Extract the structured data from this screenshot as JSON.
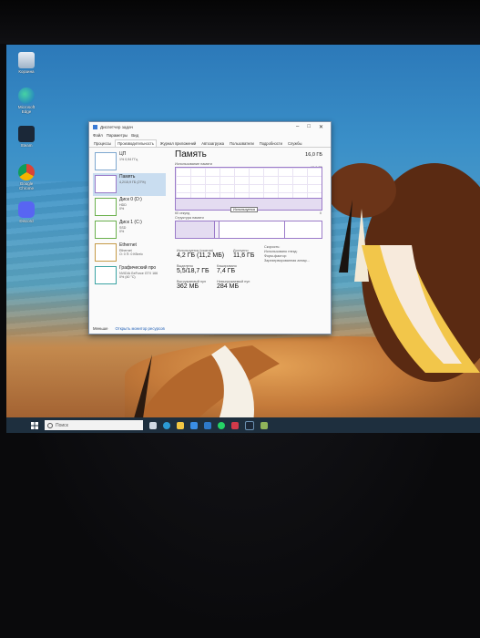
{
  "desktop": {
    "icons": [
      {
        "label": "Корзина",
        "icon": "recycle-bin-icon"
      },
      {
        "label": "Microsoft Edge",
        "icon": "edge-icon"
      },
      {
        "label": "Steam",
        "icon": "steam-icon"
      },
      {
        "label": "Google Chrome",
        "icon": "chrome-icon"
      },
      {
        "label": "Discord",
        "icon": "discord-icon"
      }
    ]
  },
  "task_manager": {
    "title": "Диспетчер задач",
    "menu": [
      "Файл",
      "Параметры",
      "Вид"
    ],
    "tabs": [
      "Процессы",
      "Производительность",
      "Журнал приложений",
      "Автозагрузка",
      "Пользователи",
      "Подробности",
      "Службы"
    ],
    "active_tab": "Производительность",
    "resources": [
      {
        "name": "ЦП",
        "sub": "1% 0,94 ГГц",
        "sub2": ""
      },
      {
        "name": "Память",
        "sub": "4,2/15,9 ГБ (27%)",
        "sub2": ""
      },
      {
        "name": "Диск 0 (D:)",
        "sub": "HDD",
        "sub2": "0%"
      },
      {
        "name": "Диск 1 (C:)",
        "sub": "SSD",
        "sub2": "0%"
      },
      {
        "name": "Ethernet",
        "sub": "Ethernet",
        "sub2": "О: 0 П: 0 Кбит/с"
      },
      {
        "name": "Графический про",
        "sub": "NVIDIA GeForce GTX 166",
        "sub2": "0% (40 °C)"
      }
    ],
    "detail": {
      "title": "Память",
      "capacity": "16,0 ГБ",
      "graph_label": "Использование памяти",
      "graph_max": "15,9 ГБ",
      "graph_time": "60 секунд",
      "graph_zero": "0",
      "tooltip": "Используется",
      "usage_fraction": 0.27,
      "structure_label": "Структура памяти",
      "stats": {
        "in_use_label": "Используется (сжатая)",
        "in_use_value": "4,2 ГБ (11,2 МБ)",
        "available_label": "Доступно",
        "available_value": "11,6 ГБ",
        "committed_label": "Выделено",
        "committed_value": "5,5/18,7 ГБ",
        "cached_label": "Кэшировано",
        "cached_value": "7,4 ГБ",
        "paged_label": "Выгружаемый пул",
        "paged_value": "362 МБ",
        "nonpaged_label": "Невыгружаемый пул",
        "nonpaged_value": "284 МБ"
      },
      "side": [
        "Скорость:",
        "Использовано гнезд:",
        "Форм-фактор:",
        "Зарезервированная аппар..."
      ]
    },
    "footer": {
      "less": "Меньше",
      "monitor": "Открыть монитор ресурсов"
    }
  },
  "taskbar": {
    "search_placeholder": "Поиск",
    "apps": [
      "task-view-icon",
      "edge-icon",
      "explorer-icon",
      "store-icon",
      "mail-icon",
      "whatsapp-icon",
      "media-icon",
      "steam-icon",
      "task-manager-icon"
    ]
  }
}
